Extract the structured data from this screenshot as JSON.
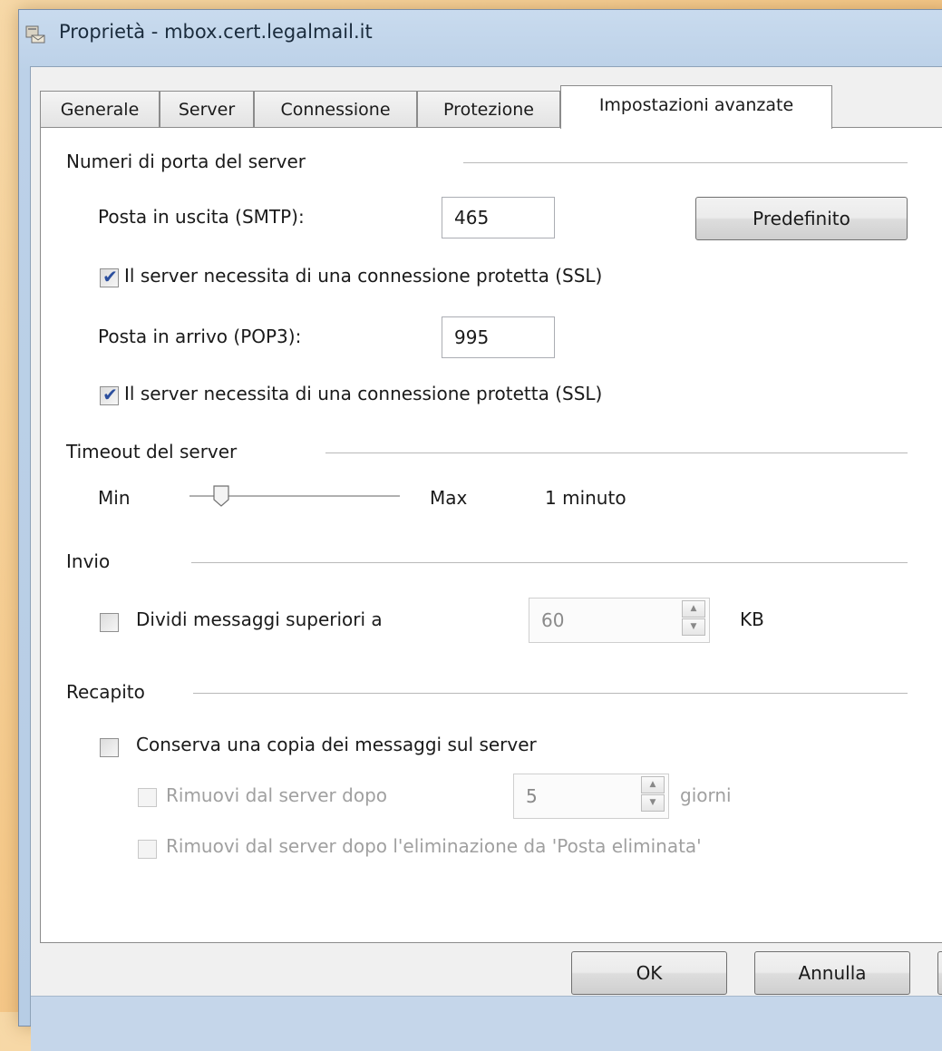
{
  "window": {
    "title": "Proprietà - mbox.cert.legalmail.it"
  },
  "tabs": [
    {
      "label": "Generale",
      "active": false
    },
    {
      "label": "Server",
      "active": false
    },
    {
      "label": "Connessione",
      "active": false
    },
    {
      "label": "Protezione",
      "active": false
    },
    {
      "label": "Impostazioni avanzate",
      "active": true
    }
  ],
  "ports": {
    "group_label": "Numeri di porta del server",
    "smtp_label": "Posta in uscita (SMTP):",
    "smtp_value": "465",
    "default_button": "Predefinito",
    "smtp_ssl_label": "Il server necessita di una connessione protetta (SSL)",
    "smtp_ssl_checked": true,
    "pop3_label": "Posta in arrivo (POP3):",
    "pop3_value": "995",
    "pop3_ssl_label": "Il server necessita di una connessione protetta (SSL)",
    "pop3_ssl_checked": true
  },
  "timeout": {
    "group_label": "Timeout del server",
    "min_label": "Min",
    "max_label": "Max",
    "value_text": "1 minuto",
    "slider_level": 0.15
  },
  "sending": {
    "group_label": "Invio",
    "split_label": "Dividi messaggi superiori a",
    "split_checked": false,
    "split_value": "60",
    "unit": "KB"
  },
  "delivery": {
    "group_label": "Recapito",
    "keep_copy_label": "Conserva una copia dei messaggi sul server",
    "keep_copy_checked": false,
    "remove_after_label": "Rimuovi dal server dopo",
    "remove_after_value": "5",
    "days_label": "giorni",
    "remove_deleted_label": "Rimuovi dal server dopo l'eliminazione da 'Posta eliminata'"
  },
  "buttons": {
    "ok": "OK",
    "cancel": "Annulla"
  },
  "icons": {
    "window": "mail-account-icon",
    "check": "checkmark-icon"
  }
}
